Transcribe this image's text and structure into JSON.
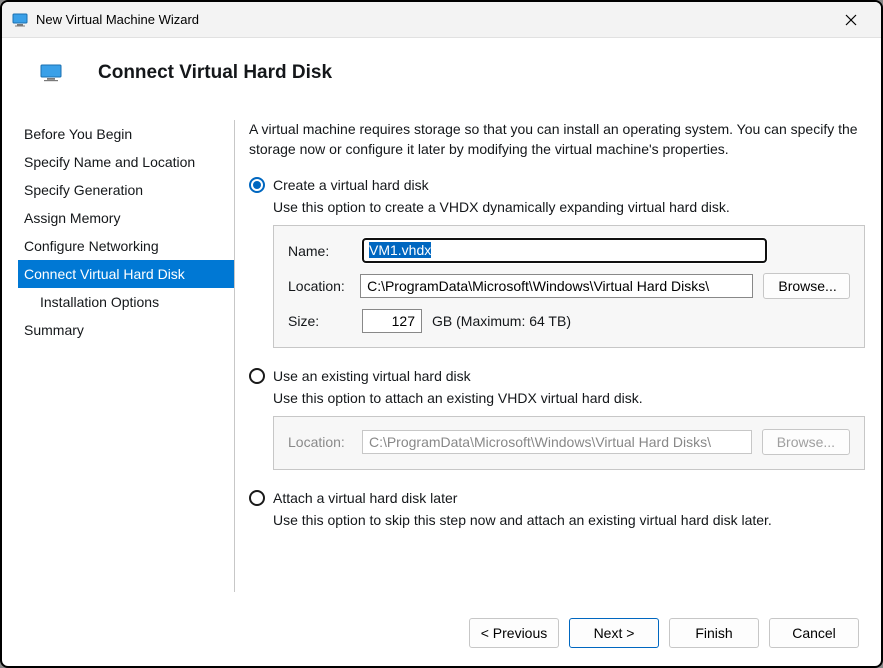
{
  "window": {
    "title": "New Virtual Machine Wizard"
  },
  "header": {
    "title": "Connect Virtual Hard Disk"
  },
  "sidebar": {
    "items": [
      {
        "label": "Before You Begin",
        "selected": false,
        "indent": false
      },
      {
        "label": "Specify Name and Location",
        "selected": false,
        "indent": false
      },
      {
        "label": "Specify Generation",
        "selected": false,
        "indent": false
      },
      {
        "label": "Assign Memory",
        "selected": false,
        "indent": false
      },
      {
        "label": "Configure Networking",
        "selected": false,
        "indent": false
      },
      {
        "label": "Connect Virtual Hard Disk",
        "selected": true,
        "indent": false
      },
      {
        "label": "Installation Options",
        "selected": false,
        "indent": true
      },
      {
        "label": "Summary",
        "selected": false,
        "indent": false
      }
    ]
  },
  "content": {
    "intro": "A virtual machine requires storage so that you can install an operating system. You can specify the storage now or configure it later by modifying the virtual machine's properties.",
    "opt_create": {
      "label": "Create a virtual hard disk",
      "desc": "Use this option to create a VHDX dynamically expanding virtual hard disk.",
      "name_label": "Name:",
      "name_value": "VM1.vhdx",
      "location_label": "Location:",
      "location_value": "C:\\ProgramData\\Microsoft\\Windows\\Virtual Hard Disks\\",
      "browse_label": "Browse...",
      "size_label": "Size:",
      "size_value": "127",
      "size_suffix": "GB (Maximum: 64 TB)"
    },
    "opt_existing": {
      "label": "Use an existing virtual hard disk",
      "desc": "Use this option to attach an existing VHDX virtual hard disk.",
      "location_label": "Location:",
      "location_value": "C:\\ProgramData\\Microsoft\\Windows\\Virtual Hard Disks\\",
      "browse_label": "Browse..."
    },
    "opt_later": {
      "label": "Attach a virtual hard disk later",
      "desc": "Use this option to skip this step now and attach an existing virtual hard disk later."
    }
  },
  "footer": {
    "previous": "< Previous",
    "next": "Next >",
    "finish": "Finish",
    "cancel": "Cancel"
  }
}
